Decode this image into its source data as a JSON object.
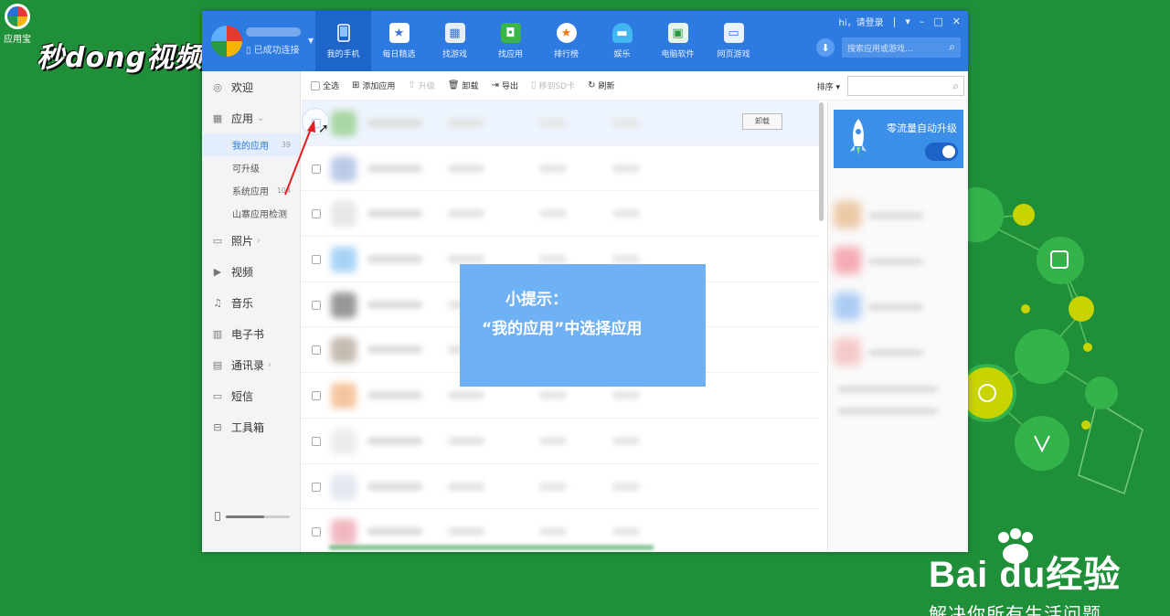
{
  "desktop": {
    "icon_label": "应用宝",
    "watermark_top": "秒dong视频",
    "baidu_logo": "Bai du经验",
    "baidu_slogan": "解决你所有生活问题"
  },
  "header": {
    "connected_text": "已成功连接",
    "login_text": "hi，请登录",
    "search_placeholder": "搜索应用或游戏...",
    "nav": [
      {
        "label": "我的手机",
        "icon": "phone-icon",
        "active": true
      },
      {
        "label": "每日精选",
        "icon": "calendar-star-icon",
        "active": false
      },
      {
        "label": "找游戏",
        "icon": "gamepad-icon",
        "active": false
      },
      {
        "label": "找应用",
        "icon": "bag-icon",
        "active": false
      },
      {
        "label": "排行榜",
        "icon": "medal-icon",
        "active": false
      },
      {
        "label": "娱乐",
        "icon": "entertainment-icon",
        "active": false
      },
      {
        "label": "电脑软件",
        "icon": "monitor-icon",
        "active": false
      },
      {
        "label": "网页游戏",
        "icon": "web-game-icon",
        "active": false
      }
    ]
  },
  "sidebar": {
    "items": [
      {
        "label": "欢迎",
        "icon": "welcome-icon"
      },
      {
        "label": "应用",
        "icon": "apps-grid-icon"
      },
      {
        "label": "照片",
        "icon": "photo-icon"
      },
      {
        "label": "视频",
        "icon": "video-icon"
      },
      {
        "label": "音乐",
        "icon": "music-icon"
      },
      {
        "label": "电子书",
        "icon": "book-icon"
      },
      {
        "label": "通讯录",
        "icon": "contacts-icon"
      },
      {
        "label": "短信",
        "icon": "sms-icon"
      },
      {
        "label": "工具箱",
        "icon": "toolbox-icon"
      }
    ],
    "subitems": [
      {
        "label": "我的应用",
        "count": "39",
        "active": true
      },
      {
        "label": "可升级",
        "count": "",
        "active": false
      },
      {
        "label": "系统应用",
        "count": "104",
        "active": false
      },
      {
        "label": "山寨应用检测",
        "count": "",
        "active": false
      }
    ],
    "storage_fraction": 0.6
  },
  "toolbar": {
    "select_all": "全选",
    "add_app": "添加应用",
    "upgrade": "升级",
    "uninstall": "卸载",
    "export": "导出",
    "move_sd": "移到SD卡",
    "refresh": "刷新",
    "sort": "排序"
  },
  "list": {
    "uninstall_button": "卸载"
  },
  "right_panel": {
    "promo_title": "零流量自动升级",
    "toggle_on": true
  },
  "tip": {
    "title": "小提示：",
    "body": "“我的应用”中选择应用"
  }
}
